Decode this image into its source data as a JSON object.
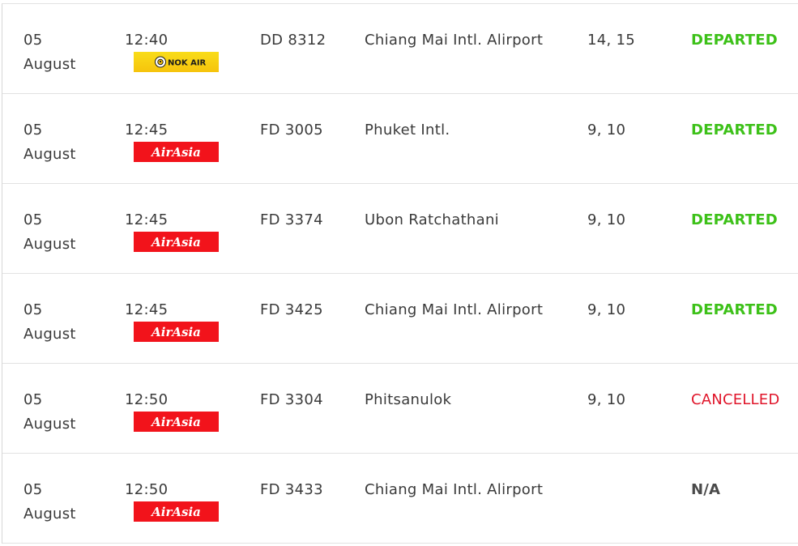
{
  "colors": {
    "departed": "#3dc119",
    "cancelled": "#e0162b",
    "na": "#4a4a4a",
    "airasia_red": "#f2131b",
    "nokair_yellow": "#f9dd19"
  },
  "flights": [
    {
      "day": "05",
      "month": "August",
      "time": "12:40",
      "airline_logo": "nok-air-logo",
      "airline_text": "NOK AIR",
      "flight": "DD 8312",
      "destination": "Chiang Mai Intl. Alirport",
      "gate": "14, 15",
      "status": "DEPARTED",
      "status_type": "departed"
    },
    {
      "day": "05",
      "month": "August",
      "time": "12:45",
      "airline_logo": "airasia-logo",
      "airline_text": "AirAsia",
      "flight": "FD 3005",
      "destination": "Phuket Intl.",
      "gate": "9, 10",
      "status": "DEPARTED",
      "status_type": "departed"
    },
    {
      "day": "05",
      "month": "August",
      "time": "12:45",
      "airline_logo": "airasia-logo",
      "airline_text": "AirAsia",
      "flight": "FD 3374",
      "destination": "Ubon Ratchathani",
      "gate": "9, 10",
      "status": "DEPARTED",
      "status_type": "departed"
    },
    {
      "day": "05",
      "month": "August",
      "time": "12:45",
      "airline_logo": "airasia-logo",
      "airline_text": "AirAsia",
      "flight": "FD 3425",
      "destination": "Chiang Mai Intl. Alirport",
      "gate": "9, 10",
      "status": "DEPARTED",
      "status_type": "departed"
    },
    {
      "day": "05",
      "month": "August",
      "time": "12:50",
      "airline_logo": "airasia-logo",
      "airline_text": "AirAsia",
      "flight": "FD 3304",
      "destination": "Phitsanulok",
      "gate": "9, 10",
      "status": "CANCELLED",
      "status_type": "cancelled"
    },
    {
      "day": "05",
      "month": "August",
      "time": "12:50",
      "airline_logo": "airasia-logo",
      "airline_text": "AirAsia",
      "flight": "FD 3433",
      "destination": "Chiang Mai Intl. Alirport",
      "gate": "",
      "status": "N/A",
      "status_type": "na"
    }
  ]
}
